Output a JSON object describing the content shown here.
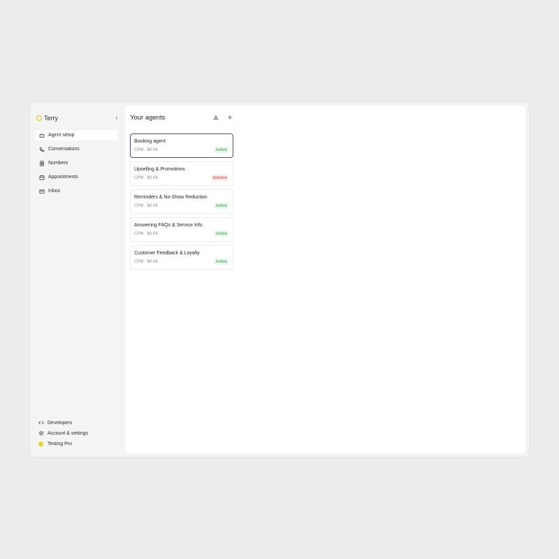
{
  "sidebar": {
    "brand": "Terry",
    "collapse_icon": "chevron-left-icon",
    "items": [
      {
        "label": "Agent setup",
        "icon": "robot-icon",
        "active": true
      },
      {
        "label": "Conversations",
        "icon": "phone-icon",
        "active": false
      },
      {
        "label": "Numbers",
        "icon": "sim-card-icon",
        "active": false
      },
      {
        "label": "Appointments",
        "icon": "calendar-icon",
        "active": false
      },
      {
        "label": "Inbox",
        "icon": "mail-icon",
        "active": false
      }
    ],
    "bottom": [
      {
        "label": "Developers",
        "icon": "code-icon"
      },
      {
        "label": "Account & settings",
        "icon": "gear-icon"
      },
      {
        "label": "Testing Pro",
        "icon": "avatar"
      }
    ]
  },
  "main": {
    "title": "Your agents",
    "download_icon": "download-icon",
    "add_icon": "plus-icon",
    "agents": [
      {
        "name": "Booking agent",
        "cpm": "CPM · $0.04",
        "status": "Active",
        "selected": true
      },
      {
        "name": "Upselling & Promotions",
        "cpm": "CPM · $0.04",
        "status": "Inactive",
        "selected": false
      },
      {
        "name": "Reminders & No-Show Reduction",
        "cpm": "CPM · $0.04",
        "status": "Active",
        "selected": false
      },
      {
        "name": "Answering FAQs & Service Info",
        "cpm": "CPM · $0.04",
        "status": "Active",
        "selected": false
      },
      {
        "name": "Customer Feedback & Loyalty",
        "cpm": "CPM · $0.04",
        "status": "Active",
        "selected": false
      }
    ]
  },
  "colors": {
    "accent": "#5b3fa6",
    "active_text": "#2e9e3e",
    "active_bg": "#eaf7ec",
    "inactive_text": "#d23b2f",
    "inactive_bg": "#fdeceb",
    "brand_yellow": "#e7d322"
  }
}
